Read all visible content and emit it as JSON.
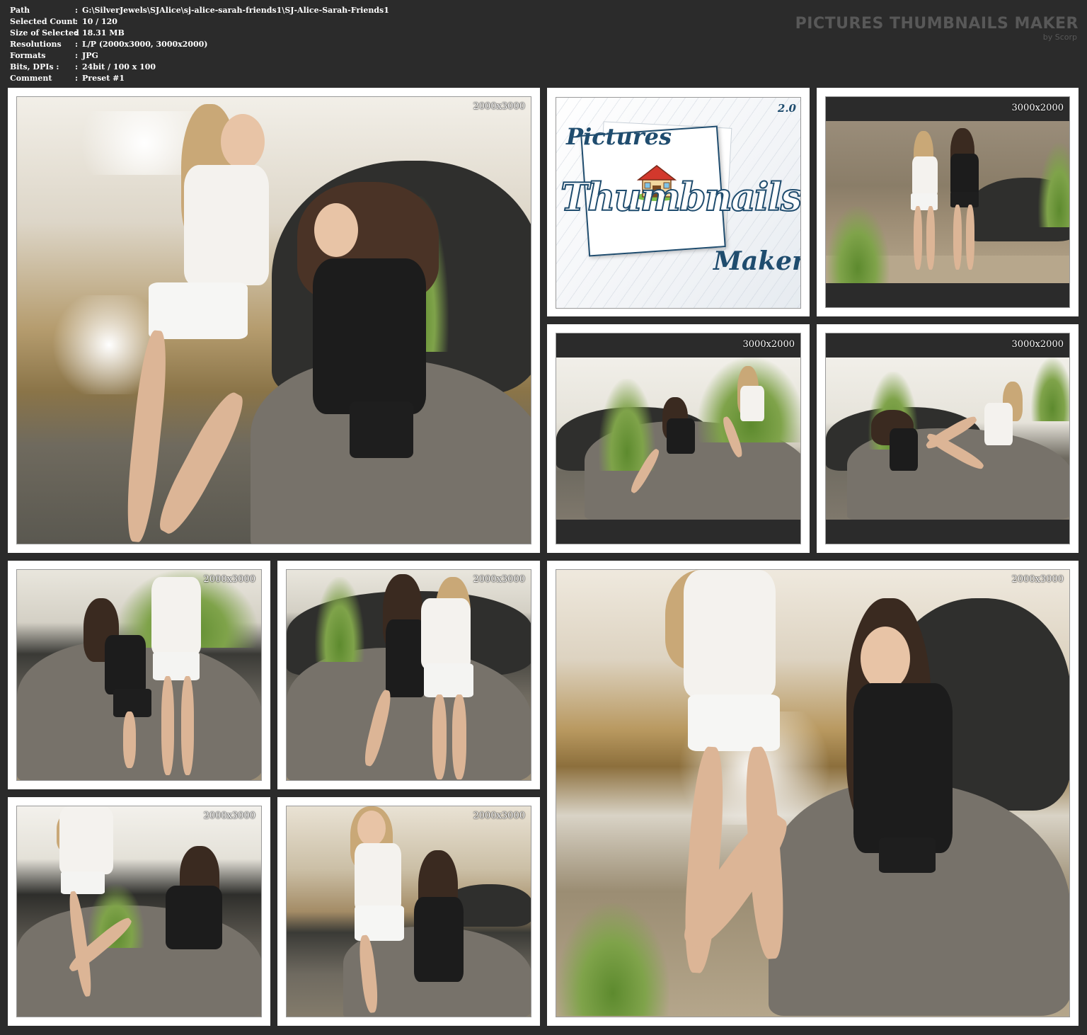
{
  "info": {
    "rows": [
      {
        "key": "Path",
        "sep": ":",
        "value": "G:\\SilverJewels\\SJAlice\\sj-alice-sarah-friends1\\SJ-Alice-Sarah-Friends1"
      },
      {
        "key": "Selected Count",
        "sep": ":",
        "value": "10 / 120"
      },
      {
        "key": "Size of Selected",
        "sep": ":",
        "value": "18.31 MB"
      },
      {
        "key": "Resolutions",
        "sep": ":",
        "value": "L/P (2000x3000, 3000x2000)"
      },
      {
        "key": "Formats",
        "sep": ":",
        "value": "JPG"
      },
      {
        "key": "Bits, DPIs :",
        "sep": ":",
        "value": "24bit / 100 x 100"
      },
      {
        "key": "Comment",
        "sep": ":",
        "value": "Preset #1"
      }
    ]
  },
  "brand": {
    "title": "PICTURES THUMBNAILS MAKER",
    "subtitle": "by Scorp"
  },
  "logo": {
    "word1": "Pictures",
    "word2": "Thumbnails",
    "word3": "Maker",
    "version": "2.0"
  },
  "thumbnails": [
    {
      "resolution": "2000x3000"
    },
    {
      "resolution": "3000x2000"
    },
    {
      "resolution": "3000x2000"
    },
    {
      "resolution": "3000x2000"
    },
    {
      "resolution": "2000x3000"
    },
    {
      "resolution": "2000x3000"
    },
    {
      "resolution": "2000x3000"
    },
    {
      "resolution": "2000x3000"
    },
    {
      "resolution": "2000x3000"
    }
  ],
  "colors": {
    "background": "#2b2b2b",
    "frame": "#ffffff",
    "brand_text": "#585858",
    "logo_blue": "#1f4c6e"
  }
}
